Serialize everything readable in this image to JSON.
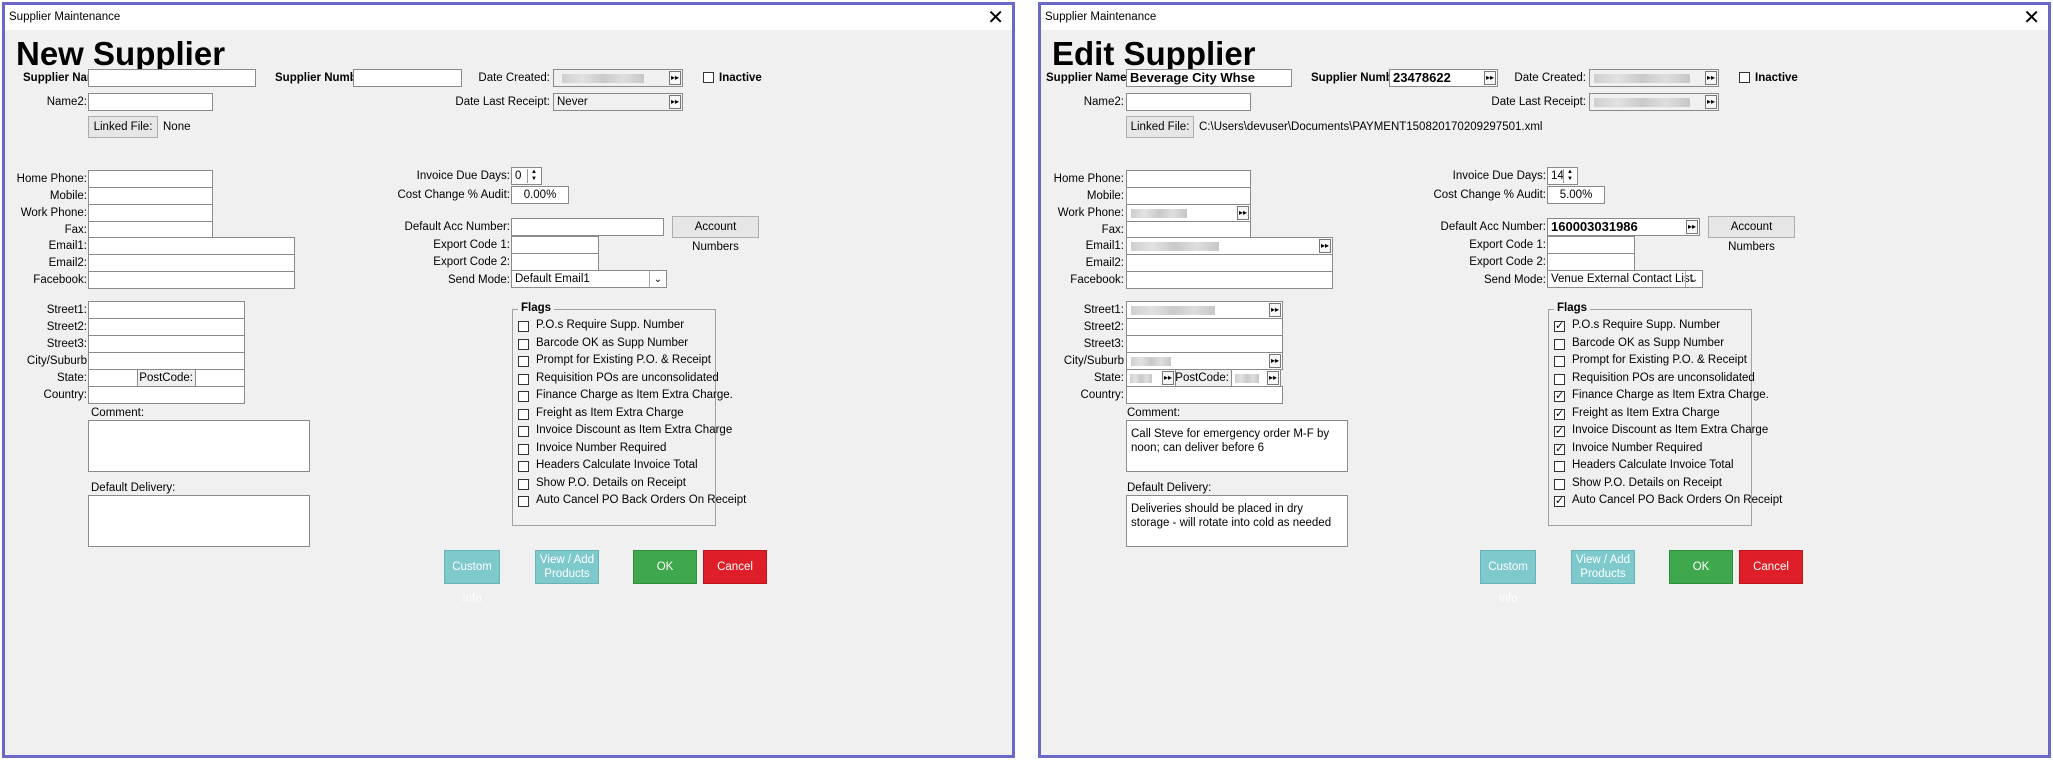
{
  "left": {
    "window_title": "Supplier Maintenance",
    "heading": "New Supplier",
    "labels": {
      "supplier_name": "Supplier Name:",
      "supplier_number": "Supplier Number:",
      "date_created": "Date Created:",
      "inactive": "Inactive",
      "name2": "Name2:",
      "date_last_receipt": "Date Last Receipt:",
      "linked_file": "Linked File:",
      "home_phone": "Home Phone:",
      "mobile": "Mobile:",
      "work_phone": "Work Phone:",
      "fax": "Fax:",
      "email1": "Email1:",
      "email2": "Email2:",
      "facebook": "Facebook:",
      "invoice_due_days": "Invoice Due Days:",
      "cost_change": "Cost Change % Audit:",
      "default_acc": "Default Acc Number:",
      "account_numbers": "Account Numbers",
      "export1": "Export Code 1:",
      "export2": "Export Code 2:",
      "send_mode": "Send Mode:",
      "street1": "Street1:",
      "street2": "Street2:",
      "street3": "Street3:",
      "city": "City/Suburb",
      "state": "State:",
      "postcode": "PostCode:",
      "country": "Country:",
      "comment": "Comment:",
      "default_delivery": "Default Delivery:",
      "flags": "Flags"
    },
    "values": {
      "supplier_name": "",
      "supplier_number": "",
      "date_last_receipt": "Never",
      "linked_file": "None",
      "invoice_due_days": "0",
      "cost_change": "0.00%",
      "default_acc": "",
      "send_mode": "Default Email1",
      "comment": "",
      "default_delivery": ""
    },
    "flags": [
      {
        "label": "P.O.s Require Supp. Number",
        "checked": false
      },
      {
        "label": "Barcode OK as Supp Number",
        "checked": false
      },
      {
        "label": "Prompt for Existing P.O. & Receipt",
        "checked": false
      },
      {
        "label": "Requisition POs are unconsolidated",
        "checked": false
      },
      {
        "label": "Finance Charge as Item Extra Charge.",
        "checked": false
      },
      {
        "label": "Freight as Item Extra Charge",
        "checked": false
      },
      {
        "label": "Invoice Discount as Item Extra Charge",
        "checked": false
      },
      {
        "label": "Invoice Number Required",
        "checked": false
      },
      {
        "label": "Headers Calculate Invoice Total",
        "checked": false
      },
      {
        "label": "Show P.O. Details on Receipt",
        "checked": false
      },
      {
        "label": "Auto Cancel PO Back Orders On Receipt",
        "checked": false
      }
    ],
    "buttons": {
      "custom_info": "Custom Info",
      "view_add_1": "View / Add",
      "view_add_2": "Products",
      "ok": "OK",
      "cancel": "Cancel"
    }
  },
  "right": {
    "window_title": "Supplier Maintenance",
    "heading": "Edit Supplier",
    "labels": {
      "supplier_name": "Supplier Name:",
      "supplier_number": "Supplier Number:",
      "date_created": "Date Created:",
      "inactive": "Inactive",
      "name2": "Name2:",
      "date_last_receipt": "Date Last Receipt:",
      "linked_file": "Linked File:",
      "home_phone": "Home Phone:",
      "mobile": "Mobile:",
      "work_phone": "Work Phone:",
      "fax": "Fax:",
      "email1": "Email1:",
      "email2": "Email2:",
      "facebook": "Facebook:",
      "invoice_due_days": "Invoice Due Days:",
      "cost_change": "Cost Change % Audit:",
      "default_acc": "Default Acc Number:",
      "account_numbers": "Account Numbers",
      "export1": "Export Code 1:",
      "export2": "Export Code 2:",
      "send_mode": "Send Mode:",
      "street1": "Street1:",
      "street2": "Street2:",
      "street3": "Street3:",
      "city": "City/Suburb",
      "state": "State:",
      "postcode": "PostCode:",
      "country": "Country:",
      "comment": "Comment:",
      "default_delivery": "Default Delivery:",
      "flags": "Flags"
    },
    "values": {
      "supplier_name": "Beverage City Whse",
      "supplier_number": "23478622",
      "linked_file": "C:\\Users\\devuser\\Documents\\PAYMENT150820170209297501.xml",
      "invoice_due_days": "14",
      "cost_change": "5.00%",
      "default_acc": "160003031986",
      "send_mode": "Venue External Contact List",
      "comment": "Call Steve for emergency order M-F by noon; can deliver before 6",
      "default_delivery": "Deliveries should be placed in dry storage - will rotate into cold as needed"
    },
    "flags": [
      {
        "label": "P.O.s Require Supp. Number",
        "checked": true
      },
      {
        "label": "Barcode OK as Supp Number",
        "checked": false
      },
      {
        "label": "Prompt for Existing P.O. & Receipt",
        "checked": false
      },
      {
        "label": "Requisition POs are unconsolidated",
        "checked": false
      },
      {
        "label": "Finance Charge as Item Extra Charge.",
        "checked": true
      },
      {
        "label": "Freight as Item Extra Charge",
        "checked": true
      },
      {
        "label": "Invoice Discount as Item Extra Charge",
        "checked": true
      },
      {
        "label": "Invoice Number Required",
        "checked": true
      },
      {
        "label": "Headers Calculate Invoice Total",
        "checked": false
      },
      {
        "label": "Show P.O. Details on Receipt",
        "checked": false
      },
      {
        "label": "Auto Cancel PO Back Orders On Receipt",
        "checked": true
      }
    ],
    "buttons": {
      "custom_info": "Custom Info",
      "view_add_1": "View / Add",
      "view_add_2": "Products",
      "ok": "OK",
      "cancel": "Cancel"
    }
  },
  "colors": {
    "window_border": "#6b69c8",
    "ok": "#3fa84c",
    "cancel": "#de1e28",
    "secondary": "#7ec9cc"
  }
}
